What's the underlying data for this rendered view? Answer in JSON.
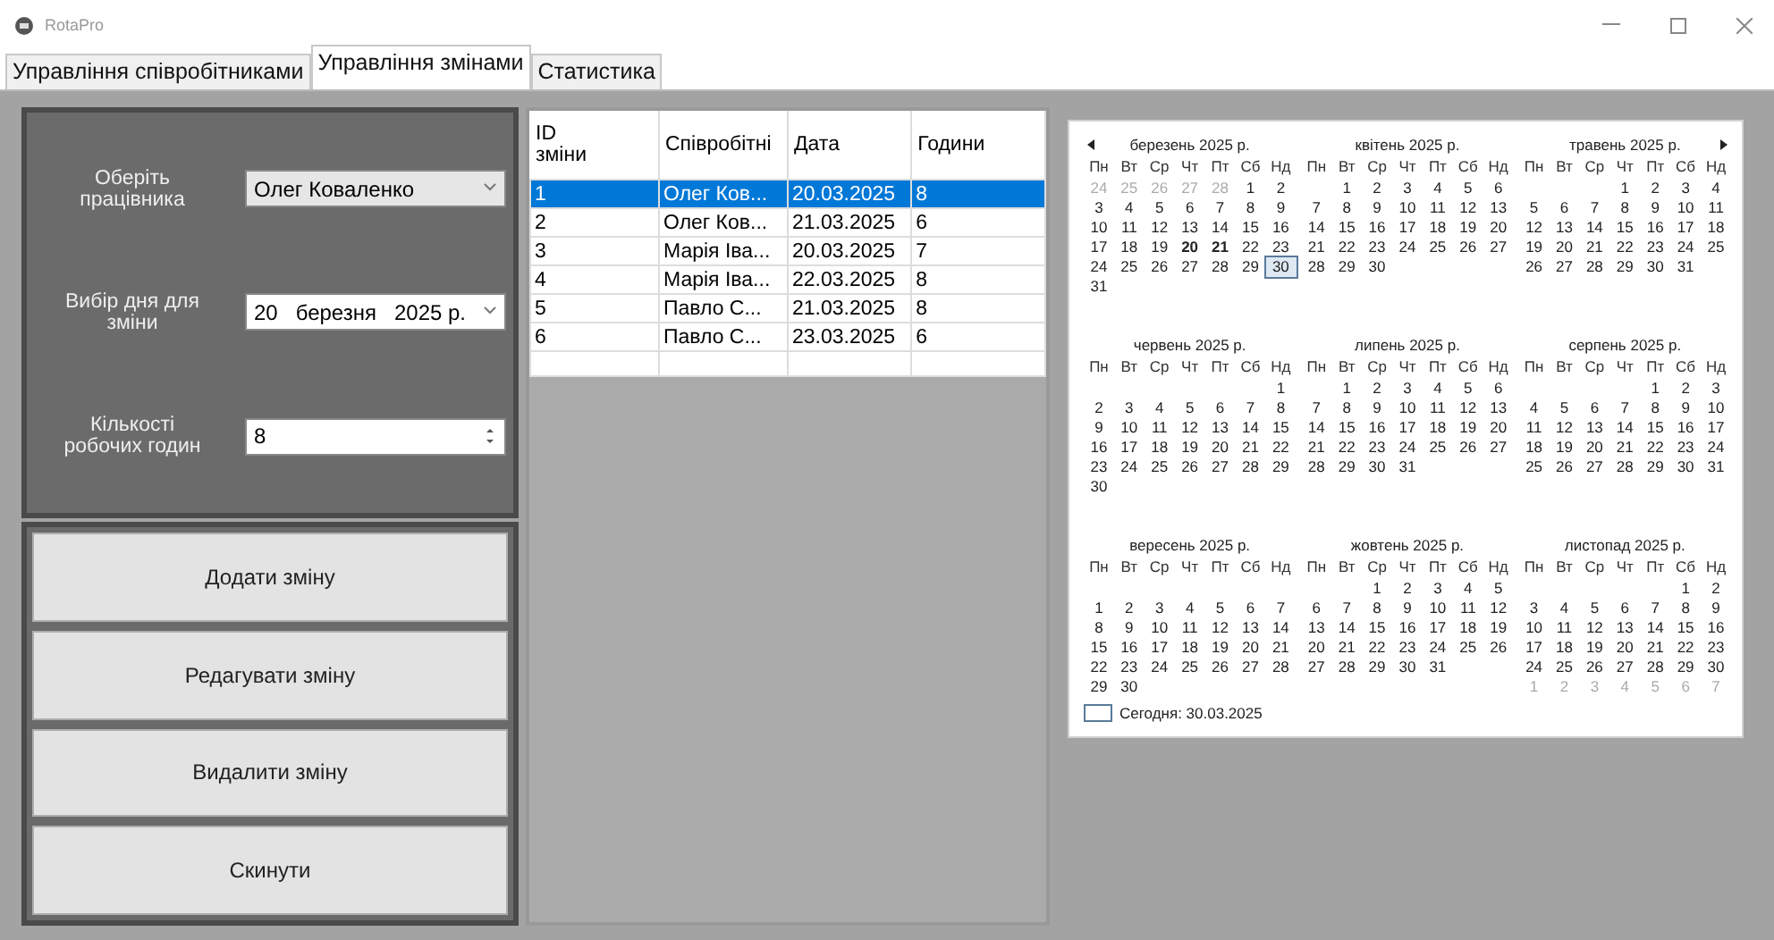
{
  "window": {
    "title": "RotaPro"
  },
  "tabs": [
    {
      "label": "Управління співробітниками",
      "selected": false
    },
    {
      "label": "Управління змінами",
      "selected": true
    },
    {
      "label": "Статистика",
      "selected": false
    }
  ],
  "form": {
    "fields": [
      {
        "label": "Оберіть працівника",
        "value": "Олег Коваленко",
        "kind": "combo"
      },
      {
        "label": "Вибір дня для зміни",
        "value": "20   березня   2025 р.",
        "kind": "date"
      },
      {
        "label": "Кількості робочих годин",
        "value": "8",
        "kind": "spin"
      }
    ]
  },
  "buttons": [
    "Додати зміну",
    "Редагувати зміну",
    "Видалити зміну",
    "Скинути"
  ],
  "table": {
    "columns": [
      "ID зміни",
      "Співробітні",
      "Дата",
      "Години"
    ],
    "rows": [
      {
        "cells": [
          "1",
          "Олег Ков...",
          "20.03.2025",
          "8"
        ],
        "selected": true
      },
      {
        "cells": [
          "2",
          "Олег Ков...",
          "21.03.2025",
          "6"
        ],
        "selected": false
      },
      {
        "cells": [
          "3",
          "Марія Іва...",
          "20.03.2025",
          "7"
        ],
        "selected": false
      },
      {
        "cells": [
          "4",
          "Марія Іва...",
          "22.03.2025",
          "8"
        ],
        "selected": false
      },
      {
        "cells": [
          "5",
          "Павло С...",
          "21.03.2025",
          "8"
        ],
        "selected": false
      },
      {
        "cells": [
          "6",
          "Павло С...",
          "23.03.2025",
          "6"
        ],
        "selected": false
      }
    ]
  },
  "calendar": {
    "months": [
      {
        "title": "березень 2025 р.",
        "weekdays": [
          "Пн",
          "Вт",
          "Ср",
          "Чт",
          "Пт",
          "Сб",
          "Нд"
        ],
        "weeks": [
          [
            {
              "day": "24",
              "kind": "muted"
            },
            {
              "day": "25",
              "kind": "muted"
            },
            {
              "day": "26",
              "kind": "muted"
            },
            {
              "day": "27",
              "kind": "muted"
            },
            {
              "day": "28",
              "kind": "muted"
            },
            "1",
            "2"
          ],
          [
            "3",
            "4",
            "5",
            "6",
            "7",
            "8",
            "9"
          ],
          [
            "10",
            "11",
            "12",
            "13",
            "14",
            "15",
            "16"
          ],
          [
            "17",
            "18",
            "19",
            {
              "day": "20",
              "kind": "bold"
            },
            {
              "day": "21",
              "kind": "bold"
            },
            "22",
            "23"
          ],
          [
            "24",
            "25",
            "26",
            "27",
            "28",
            "29",
            {
              "day": "30",
              "kind": "today"
            }
          ],
          [
            "31"
          ]
        ]
      },
      {
        "title": "квітень 2025 р.",
        "weekdays": [
          "Пн",
          "Вт",
          "Ср",
          "Чт",
          "Пт",
          "Сб",
          "Нд"
        ],
        "weeks": [
          [
            "1",
            "2",
            "3",
            "4",
            "5",
            "6"
          ],
          [
            "7",
            "8",
            "9",
            "10",
            "11",
            "12",
            "13"
          ],
          [
            "14",
            "15",
            "16",
            "17",
            "18",
            "19",
            "20"
          ],
          [
            "21",
            "22",
            "23",
            "24",
            "25",
            "26",
            "27"
          ],
          [
            "28",
            "29",
            "30"
          ]
        ]
      },
      {
        "title": "травень 2025 р.",
        "weekdays": [
          "Пн",
          "Вт",
          "Ср",
          "Чт",
          "Пт",
          "Сб",
          "Нд"
        ],
        "weeks": [
          [
            "1",
            "2",
            "3",
            "4"
          ],
          [
            "5",
            "6",
            "7",
            "8",
            "9",
            "10",
            "11"
          ],
          [
            "12",
            "13",
            "14",
            "15",
            "16",
            "17",
            "18"
          ],
          [
            "19",
            "20",
            "21",
            "22",
            "23",
            "24",
            "25"
          ],
          [
            "26",
            "27",
            "28",
            "29",
            "30",
            "31"
          ]
        ]
      },
      {
        "title": "червень 2025 р.",
        "weekdays": [
          "Пн",
          "Вт",
          "Ср",
          "Чт",
          "Пт",
          "Сб",
          "Нд"
        ],
        "weeks": [
          [
            "1"
          ],
          [
            "2",
            "3",
            "4",
            "5",
            "6",
            "7",
            "8"
          ],
          [
            "9",
            "10",
            "11",
            "12",
            "13",
            "14",
            "15"
          ],
          [
            "16",
            "17",
            "18",
            "19",
            "20",
            "21",
            "22"
          ],
          [
            "23",
            "24",
            "25",
            "26",
            "27",
            "28",
            "29"
          ],
          [
            "30"
          ]
        ]
      },
      {
        "title": "липень 2025 р.",
        "weekdays": [
          "Пн",
          "Вт",
          "Ср",
          "Чт",
          "Пт",
          "Сб",
          "Нд"
        ],
        "weeks": [
          [
            "1",
            "2",
            "3",
            "4",
            "5",
            "6"
          ],
          [
            "7",
            "8",
            "9",
            "10",
            "11",
            "12",
            "13"
          ],
          [
            "14",
            "15",
            "16",
            "17",
            "18",
            "19",
            "20"
          ],
          [
            "21",
            "22",
            "23",
            "24",
            "25",
            "26",
            "27"
          ],
          [
            "28",
            "29",
            "30",
            "31"
          ]
        ]
      },
      {
        "title": "серпень 2025 р.",
        "weekdays": [
          "Пн",
          "Вт",
          "Ср",
          "Чт",
          "Пт",
          "Сб",
          "Нд"
        ],
        "weeks": [
          [
            "1",
            "2",
            "3"
          ],
          [
            "4",
            "5",
            "6",
            "7",
            "8",
            "9",
            "10"
          ],
          [
            "11",
            "12",
            "13",
            "14",
            "15",
            "16",
            "17"
          ],
          [
            "18",
            "19",
            "20",
            "21",
            "22",
            "23",
            "24"
          ],
          [
            "25",
            "26",
            "27",
            "28",
            "29",
            "30",
            "31"
          ]
        ]
      },
      {
        "title": "вересень 2025 р.",
        "weekdays": [
          "Пн",
          "Вт",
          "Ср",
          "Чт",
          "Пт",
          "Сб",
          "Нд"
        ],
        "blank_first_week": true,
        "weeks": [
          [
            "1",
            "2",
            "3",
            "4",
            "5",
            "6",
            "7"
          ],
          [
            "8",
            "9",
            "10",
            "11",
            "12",
            "13",
            "14"
          ],
          [
            "15",
            "16",
            "17",
            "18",
            "19",
            "20",
            "21"
          ],
          [
            "22",
            "23",
            "24",
            "25",
            "26",
            "27",
            "28"
          ],
          [
            "29",
            "30"
          ]
        ]
      },
      {
        "title": "жовтень 2025 р.",
        "weekdays": [
          "Пн",
          "Вт",
          "Ср",
          "Чт",
          "Пт",
          "Сб",
          "Нд"
        ],
        "weeks": [
          [
            "1",
            "2",
            "3",
            "4",
            "5"
          ],
          [
            "6",
            "7",
            "8",
            "9",
            "10",
            "11",
            "12"
          ],
          [
            "13",
            "14",
            "15",
            "16",
            "17",
            "18",
            "19"
          ],
          [
            "20",
            "21",
            "22",
            "23",
            "24",
            "25",
            "26"
          ],
          [
            "27",
            "28",
            "29",
            "30",
            "31"
          ]
        ]
      },
      {
        "title": "листопад 2025 р.",
        "weekdays": [
          "Пн",
          "Вт",
          "Ср",
          "Чт",
          "Пт",
          "Сб",
          "Нд"
        ],
        "weeks": [
          [
            "1",
            "2"
          ],
          [
            "3",
            "4",
            "5",
            "6",
            "7",
            "8",
            "9"
          ],
          [
            "10",
            "11",
            "12",
            "13",
            "14",
            "15",
            "16"
          ],
          [
            "17",
            "18",
            "19",
            "20",
            "21",
            "22",
            "23"
          ],
          [
            "24",
            "25",
            "26",
            "27",
            "28",
            "29",
            "30"
          ],
          [
            {
              "day": "1",
              "kind": "muted"
            },
            {
              "day": "2",
              "kind": "muted"
            },
            {
              "day": "3",
              "kind": "muted"
            },
            {
              "day": "4",
              "kind": "muted"
            },
            {
              "day": "5",
              "kind": "muted"
            },
            {
              "day": "6",
              "kind": "muted"
            },
            {
              "day": "7",
              "kind": "muted"
            }
          ]
        ]
      }
    ],
    "today": "Сегодня: 30.03.2025"
  }
}
